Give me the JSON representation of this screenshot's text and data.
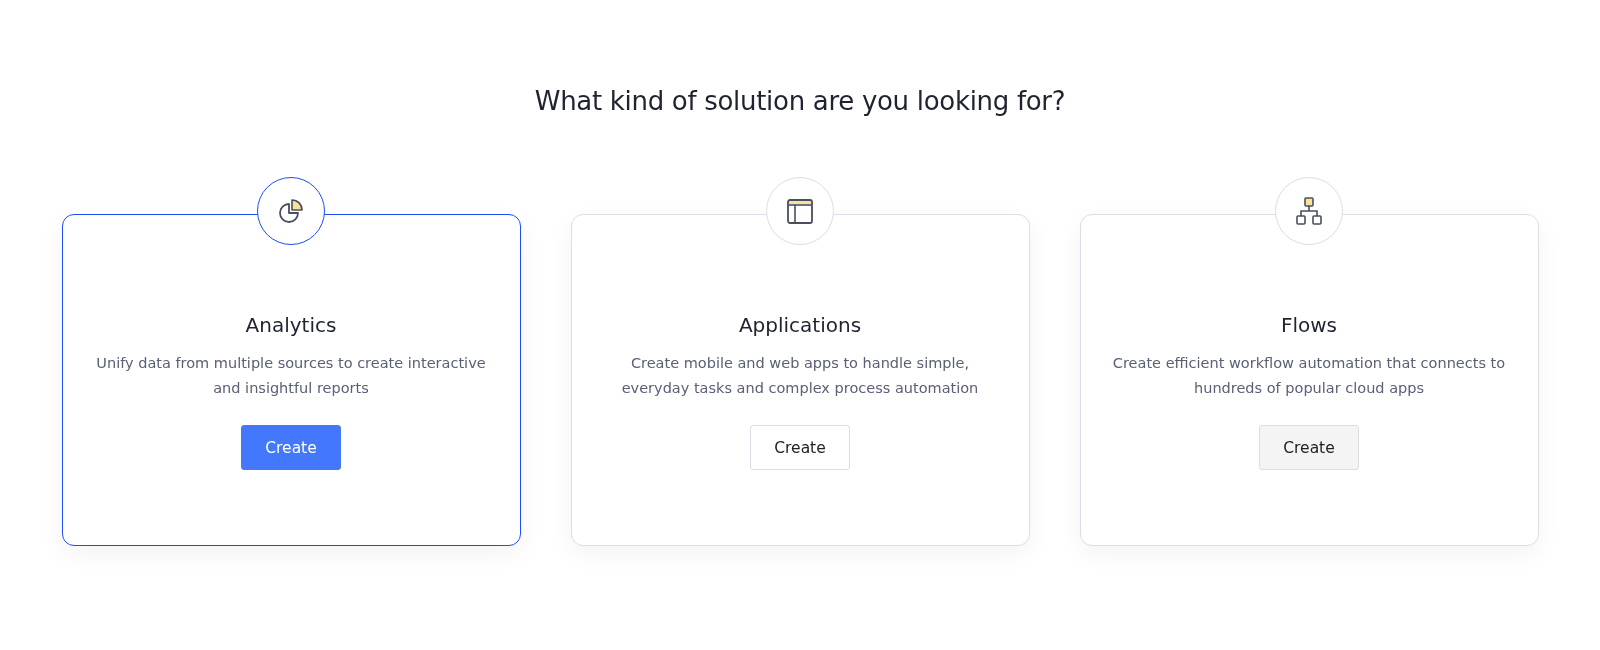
{
  "heading": "What kind of solution are you looking for?",
  "cards": [
    {
      "kind": "chart",
      "selected": true,
      "title": "Analytics",
      "description": "Unify data from multiple sources to create interactive and insightful reports",
      "button": {
        "label": "Create",
        "kind": "primary"
      }
    },
    {
      "kind": "layout",
      "selected": false,
      "title": "Applications",
      "description": "Create mobile and web apps to handle simple, everyday tasks and complex process automation",
      "button": {
        "label": "Create",
        "kind": "outline"
      }
    },
    {
      "kind": "hierarchy",
      "selected": false,
      "title": "Flows",
      "description": "Create efficient workflow automation that connects to hundreds of popular cloud apps",
      "button": {
        "label": "Create",
        "kind": "hover"
      }
    }
  ]
}
